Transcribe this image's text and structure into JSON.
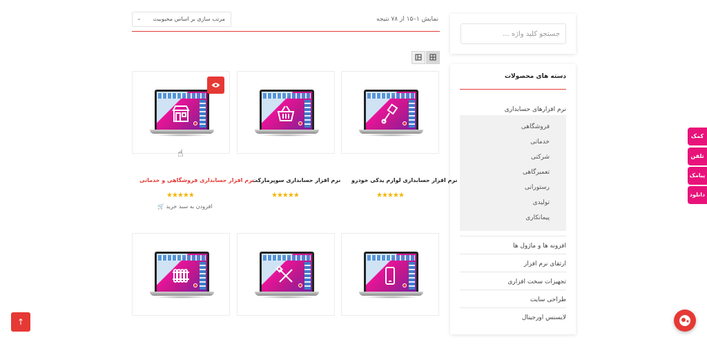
{
  "sidebar": {
    "search": {
      "placeholder": "جستجو کلید واژه ..."
    },
    "categories_title": "دسته های محصولات",
    "parent_category": "نرم افزارهای حسابداری",
    "subcategories": [
      "فروشگاهی",
      "خدماتی",
      "شرکتی",
      "تعمیرگاهی",
      "رستورانی",
      "تولیدی",
      "پیمانکاری"
    ],
    "categories": [
      "افزونه ها و ماژول ها",
      "ارتقای نرم افزار",
      "تجهیزات سخت افزاری",
      "طراحی سایت",
      "لایسنس اورجینال"
    ]
  },
  "toolbar": {
    "result_count": "نمایش ۱–۱۵ از ۷۸ نتیجه",
    "sort_label": "مرتب سازی بر اساس محبوبیت"
  },
  "products": [
    {
      "title": "نرم افزار حسابداری لوازم یدکی خودرو",
      "rating": 5,
      "icon": "piston-icon"
    },
    {
      "title": "نرم افزار حسابداری سوپرمارکت",
      "rating": 5,
      "icon": "basket-icon"
    },
    {
      "title": "نرم افزار حسابداری فروشگاهی و خدماتی",
      "rating": 5,
      "icon": "shop-icon",
      "highlight": true,
      "cart_label": "افزودن به سبد خرید"
    },
    {
      "title": "",
      "icon": "mobile-icon"
    },
    {
      "title": "",
      "icon": "tools-icon"
    },
    {
      "title": "",
      "icon": "radiator-icon"
    }
  ],
  "side_tabs": [
    "کمک",
    "تلفن",
    "پیامک",
    "دانلود"
  ],
  "colors": {
    "accent": "#e53935",
    "tab_pink": "#e8137a",
    "star": "#f4b400"
  }
}
